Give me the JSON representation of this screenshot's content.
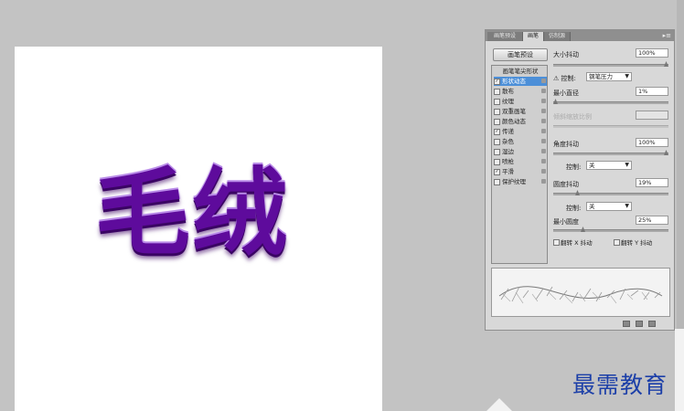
{
  "canvas": {
    "art_text": "毛绒"
  },
  "panel": {
    "tabs": [
      "画笔预设",
      "画笔",
      "仿制源"
    ],
    "active_tab": 1,
    "presets_button": "画笔预设",
    "list_header": "画笔笔尖形状",
    "items": [
      {
        "label": "形状动态",
        "checked": true,
        "selected": true
      },
      {
        "label": "散布",
        "checked": false
      },
      {
        "label": "纹理",
        "checked": false
      },
      {
        "label": "双重画笔",
        "checked": false
      },
      {
        "label": "颜色动态",
        "checked": false
      },
      {
        "label": "传递",
        "checked": true
      },
      {
        "label": "杂色",
        "checked": false
      },
      {
        "label": "湿边",
        "checked": false
      },
      {
        "label": "喷枪",
        "checked": false
      },
      {
        "label": "平滑",
        "checked": true
      },
      {
        "label": "保护纹理",
        "checked": false
      }
    ],
    "size_jitter": {
      "label": "大小抖动",
      "value": "100%"
    },
    "size_control": {
      "label": "控制:",
      "value": "钢笔压力"
    },
    "min_diameter": {
      "label": "最小直径",
      "value": "1%"
    },
    "tilt_scale": {
      "label": "倾斜缩放比例",
      "value": ""
    },
    "angle_jitter": {
      "label": "角度抖动",
      "value": "100%"
    },
    "angle_control": {
      "label": "控制:",
      "value": "关"
    },
    "roundness_jitter": {
      "label": "圆度抖动",
      "value": "19%"
    },
    "roundness_control": {
      "label": "控制:",
      "value": "关"
    },
    "min_roundness": {
      "label": "最小圆度",
      "value": "25%"
    },
    "flip_x": "翻转 X 抖动",
    "flip_y": "翻转 Y 抖动"
  },
  "watermark": "最需教育",
  "colors": {
    "text_purple": "#5e0b9c",
    "highlight": "#4c8fd8",
    "watermark_blue": "#1c3fa8"
  },
  "icons": [
    "panel-menu-icon",
    "lock-icon",
    "new-brush-icon",
    "toggle-icon",
    "delete-icon"
  ]
}
